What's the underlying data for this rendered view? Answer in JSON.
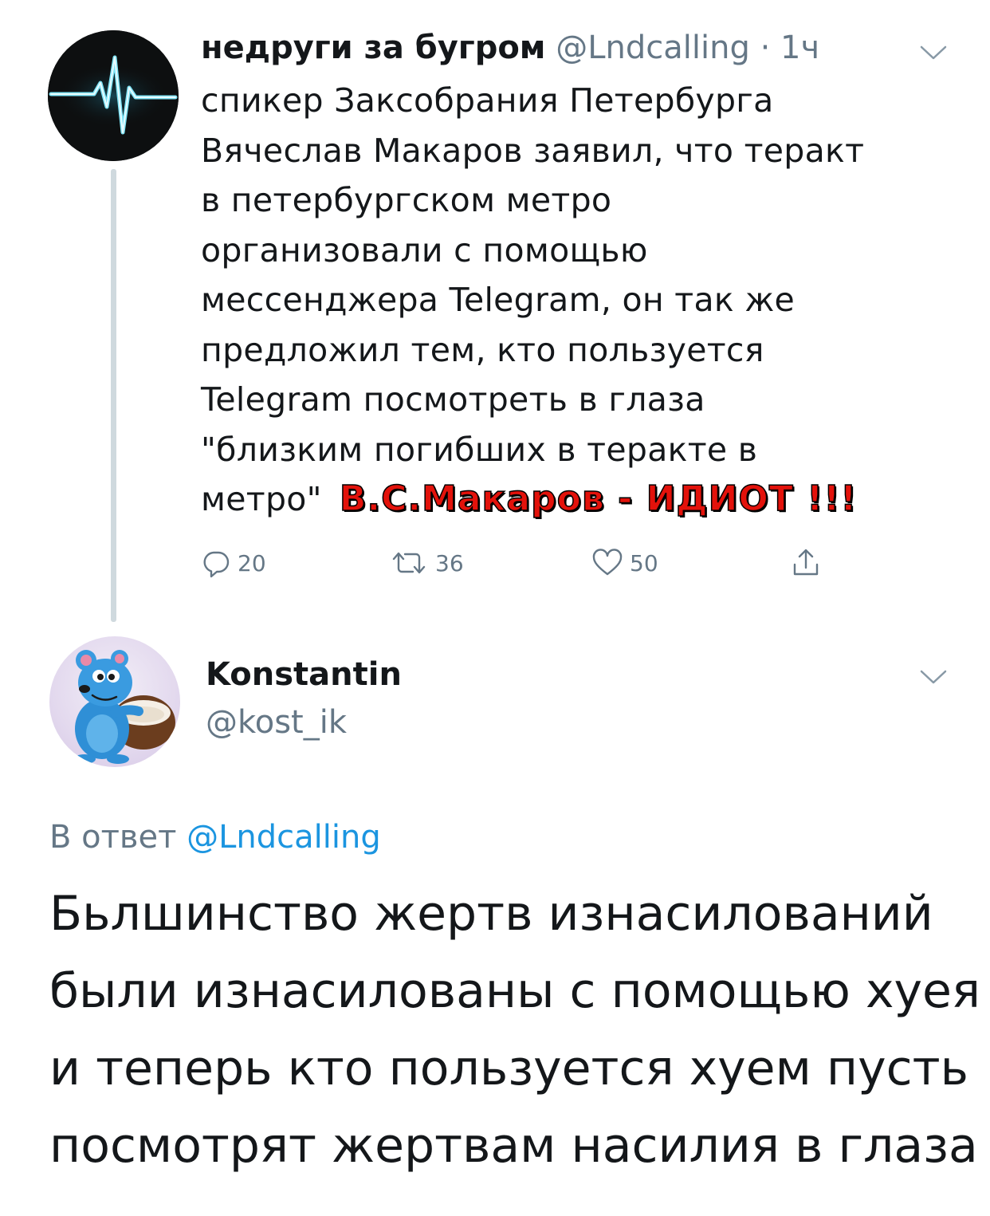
{
  "tweet1": {
    "display_name": "недруги за бугром",
    "handle": "@Lndcalling",
    "separator": "·",
    "time": "1ч",
    "text_lines": [
      "спикер Заксобрания Петербурга",
      "Вячеслав Макаров заявил, что теракт",
      "в петербургском метро",
      "организовали с помощью",
      "мессенджера Telegram, он так же",
      "предложил тем, кто пользуется",
      "Telegram посмотреть в глаза",
      "\"близким погибших в теракте в",
      "метро\""
    ],
    "overlay_stamp": "В.С.Макаров - ИДИОТ !!!",
    "replies": "20",
    "retweets": "36",
    "likes": "50"
  },
  "tweet2": {
    "display_name": "Konstantin",
    "handle": "@kost_ik",
    "replying_prefix": "В ответ",
    "replying_to": "@Lndcalling",
    "text_lines": [
      "Бьлшинство жертв  изнасилований",
      "были изнасилованы с помощью хуея",
      "и теперь кто пользуется хуем пусть",
      "посмотрят жертвам насилия в глаза"
    ]
  },
  "colors": {
    "text": "#14171a",
    "secondary": "#657786",
    "link": "#1b95e0",
    "stamp": "#e3120b",
    "thread_line": "#cfd9de"
  },
  "icons": [
    "reply-icon",
    "retweet-icon",
    "like-icon",
    "share-icon",
    "chevron-down-icon"
  ]
}
